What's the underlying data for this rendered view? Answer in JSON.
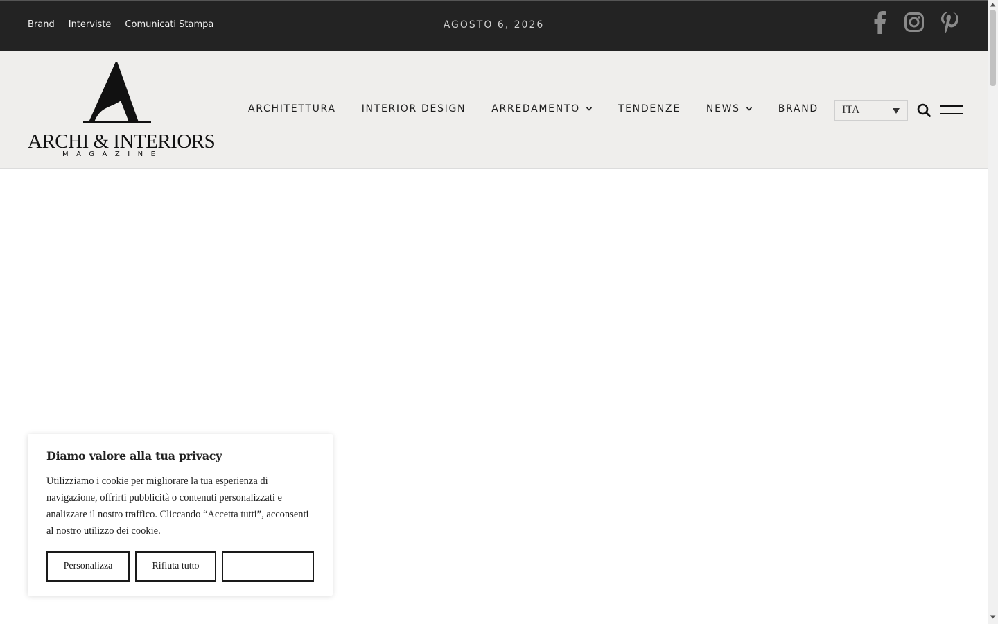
{
  "topbar": {
    "links": [
      "Brand",
      "Interviste",
      "Comunicati Stampa"
    ],
    "date": "AGOSTO 6, 2026",
    "social_icons": [
      "facebook-icon",
      "instagram-icon",
      "pinterest-icon"
    ]
  },
  "logo": {
    "title": "ARCHI & INTERIORS",
    "subtitle": "MAGAZINE"
  },
  "nav": {
    "items": [
      {
        "label": "ARCHITETTURA",
        "dropdown": false
      },
      {
        "label": "INTERIOR DESIGN",
        "dropdown": false
      },
      {
        "label": "ARREDAMENTO",
        "dropdown": true
      },
      {
        "label": "TENDENZE",
        "dropdown": false
      },
      {
        "label": "NEWS",
        "dropdown": true
      },
      {
        "label": "BRAND",
        "dropdown": false
      }
    ]
  },
  "language": {
    "selected": "ITA"
  },
  "cookie": {
    "title": "Diamo valore alla tua privacy",
    "text": "Utilizziamo i cookie per migliorare la tua esperienza di navigazione, offrirti pubblicità o contenuti personalizzati e analizzare il nostro traffico. Cliccando “Accetta tutti”, acconsenti al nostro utilizzo dei cookie.",
    "buttons": {
      "customize": "Personalizza",
      "reject": "Rifiuta tutto",
      "accept": ""
    }
  },
  "colors": {
    "topbar_bg": "#232323",
    "header_bg": "#efeeec",
    "text_dark": "#1e1e1e",
    "social_icon": "#8a8a8a"
  }
}
